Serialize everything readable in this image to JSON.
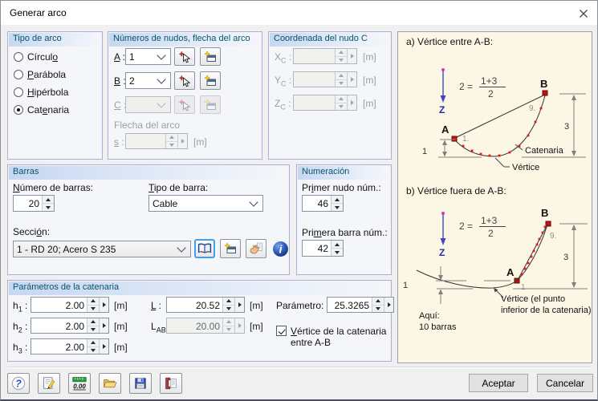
{
  "window": {
    "title": "Generar arco"
  },
  "groups": {
    "tipo": {
      "title": "Tipo de arco",
      "opt1": {
        "pre": "Círcul",
        "mn": "o",
        "post": ""
      },
      "opt2": {
        "pre": "",
        "mn": "P",
        "post": "arábola"
      },
      "opt3": {
        "pre": "",
        "mn": "H",
        "post": "ipérbola"
      },
      "opt4": {
        "pre": "Cat",
        "mn": "e",
        "post": "naria"
      },
      "selected": "Catenaria"
    },
    "nudos": {
      "title": "Números de nudos, flecha del arco",
      "a_label": {
        "pre": "",
        "mn": "A",
        "post": " :"
      },
      "a_value": "1",
      "b_label": {
        "pre": "",
        "mn": "B",
        "post": " :"
      },
      "b_value": "2",
      "c_label": {
        "pre": "",
        "mn": "C",
        "post": " :"
      },
      "c_value": "",
      "flecha_label": "Flecha del arco",
      "s_label": {
        "pre": "",
        "mn": "s",
        "post": " :"
      },
      "s_value": "",
      "s_unit": "[m]"
    },
    "coord": {
      "title": "Coordenada del nudo C",
      "x_label": {
        "base": "X",
        "sub": "C",
        "suffix": " :"
      },
      "x_value": "",
      "x_unit": "[m]",
      "y_label": {
        "base": "Y",
        "sub": "C",
        "suffix": " :"
      },
      "y_value": "",
      "y_unit": "[m]",
      "z_label": {
        "base": "Z",
        "sub": "C",
        "suffix": " :"
      },
      "z_value": "",
      "z_unit": "[m]"
    },
    "barras": {
      "title": "Barras",
      "num_label": {
        "pre": "",
        "mn": "N",
        "post": "úmero de barras:"
      },
      "num_value": "20",
      "tipo_label": {
        "pre": "",
        "mn": "T",
        "post": "ipo de barra:"
      },
      "tipo_value": "Cable",
      "seccion_label": {
        "pre": "Secci",
        "mn": "ó",
        "post": "n:"
      },
      "seccion_value": "1 - RD 20; Acero S 235"
    },
    "numeracion": {
      "title": "Numeración",
      "nudo_label": {
        "pre": "Pr",
        "mn": "i",
        "post": "mer nudo núm.:"
      },
      "nudo_value": "46",
      "barra_label": {
        "pre": "Pri",
        "mn": "m",
        "post": "era barra núm.:"
      },
      "barra_value": "42"
    },
    "parametros": {
      "title": "Parámetros de la catenaria",
      "h1_label": {
        "base": "h",
        "sub": "1",
        "suffix": " :"
      },
      "h1_value": "2.00",
      "h1_unit": "[m]",
      "h2_label": {
        "base": "h",
        "sub": "2",
        "suffix": " :"
      },
      "h2_value": "2.00",
      "h2_unit": "[m]",
      "h3_label": {
        "base": "h",
        "sub": "3",
        "suffix": " :"
      },
      "h3_value": "2.00",
      "h3_unit": "[m]",
      "L_label": {
        "pre": "",
        "mn": "L",
        "post": " :"
      },
      "L_value": "20.52",
      "L_unit": "[m]",
      "LAB_label": {
        "base": "L",
        "sub": "AB",
        "suffix": " :"
      },
      "LAB_value": "20.00",
      "LAB_unit": "[m]",
      "parametro_label": "Parámetro:",
      "parametro_value": "25.3265",
      "check_line1": {
        "pre": "",
        "mn": "V",
        "post": "értice de la catenaria"
      },
      "check_line2": "entre A-B",
      "check_checked": true
    }
  },
  "diagram": {
    "a_title": "a) Vértice entre A-B:",
    "b_title": "b) Vértice fuera de A-B:",
    "axis_label": "Z",
    "formula_lhs": "2 =",
    "formula_num": "1+3",
    "formula_den": "2",
    "node_a": "A",
    "node_b": "B",
    "first_node": "1.",
    "last_node": "9.",
    "dim_small": "1",
    "dim_large": "3",
    "catenaria_label": "Catenaria",
    "vertice_label": "Vértice",
    "vertice_b_line1": "Vértice (el punto",
    "vertice_b_line2": "inferior de la catenaria)",
    "aqui_line1": "Aquí:",
    "aqui_line2": "10 barras"
  },
  "footer": {
    "aceptar": "Aceptar",
    "cancelar": "Cancelar"
  },
  "icons": {
    "close": "thin-x",
    "pick_node": "cursor-arrow-with-red-star",
    "new_node": "window-with-yellow-star",
    "library": "open-book",
    "new_section": "window-with-yellow-star",
    "assign_section": "hand-with-sheet",
    "info": "blue-info-sphere",
    "help": "blue-question-mark",
    "comment": "sheet-with-pencil",
    "units": "green-ruler-0.00",
    "open": "yellow-folder",
    "save": "blue-floppy-disk",
    "transfer": "maroon-clamp-with-sheet"
  },
  "colors": {
    "group_header_text": "#00566e",
    "group_border": "#adaed8",
    "panel_bg": "#fcf7e5",
    "node_red": "#c41212",
    "dot_red": "#e01818",
    "axis_blue": "#4343c8"
  }
}
